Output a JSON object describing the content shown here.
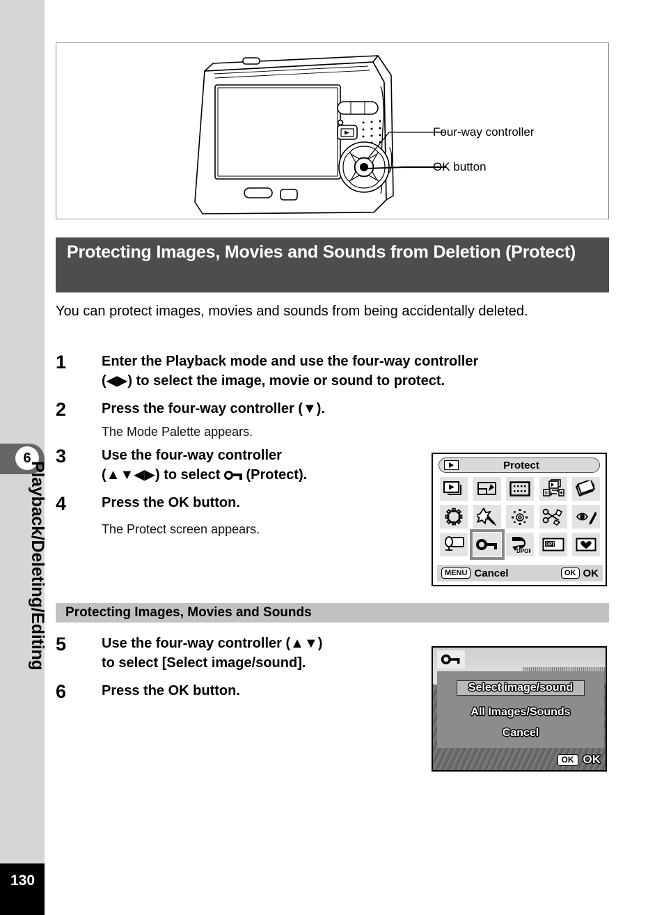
{
  "page": {
    "number": "130",
    "chapter_number": "6",
    "chapter_title": "Playback/Deleting/Editing"
  },
  "illustration": {
    "callouts": [
      {
        "label": "Four-way controller"
      },
      {
        "label": "OK button"
      }
    ],
    "camera_icons": {
      "playback_button": "playback-icon",
      "four_way": "four-way-controller-icon",
      "ok": "ok-button-icon"
    }
  },
  "section": {
    "heading": "Protecting Images, Movies and Sounds from Deletion (Protect)",
    "intro": "You can protect images, movies and sounds from being accidentally deleted."
  },
  "steps": [
    {
      "num": "1",
      "text_a": "Enter the Playback mode and use the four-way controller",
      "text_b": "(◀▶) to select the image, movie or sound to protect.",
      "note": ""
    },
    {
      "num": "2",
      "text_a": "Press the four-way controller (▼).",
      "text_b": "",
      "note": "The Mode Palette appears."
    },
    {
      "num": "3",
      "text_a": "Use the four-way controller",
      "text_b_pre": "(▲▼◀▶) to select ",
      "text_b_post": " (Protect).",
      "note": ""
    },
    {
      "num": "4",
      "text_a": "Press the OK button.",
      "text_b": "",
      "note": "The Protect screen appears."
    },
    {
      "num": "5",
      "text_a": "Use the four-way controller (▲▼)",
      "text_b": "to select [Select image/sound].",
      "note": ""
    },
    {
      "num": "6",
      "text_a": "Press the OK button.",
      "text_b": "",
      "note": ""
    }
  ],
  "subsection": {
    "band_title": "Protecting Images, Movies and Sounds"
  },
  "lcd_mode_palette": {
    "title": "Protect",
    "title_icon": "playback-mode-icon",
    "icons": [
      {
        "name": "slideshow-icon"
      },
      {
        "name": "resize-icon"
      },
      {
        "name": "cropping-icon"
      },
      {
        "name": "image-copy-icon"
      },
      {
        "name": "image-rotation-icon"
      },
      {
        "name": "frame-composite-icon"
      },
      {
        "name": "digital-filter-icon"
      },
      {
        "name": "brightness-filter-icon"
      },
      {
        "name": "red-eye-compensation-icon"
      },
      {
        "name": "digital-filter-pen-icon"
      },
      {
        "name": "voice-memo-icon"
      },
      {
        "name": "protect-key-icon"
      },
      {
        "name": "dpof-icon"
      },
      {
        "name": "start-up-screen-icon"
      },
      {
        "name": "favorite-heart-icon"
      }
    ],
    "selected_icon": "protect-key-icon",
    "bottom_bar": {
      "menu_chip": "MENU",
      "menu_label": "Cancel",
      "ok_chip": "OK",
      "ok_label": "OK"
    }
  },
  "lcd_protect_screen": {
    "badge_icon": "protect-key-icon",
    "options": [
      {
        "label": "Select image/sound",
        "selected": true
      },
      {
        "label": "All Images/Sounds",
        "selected": false
      },
      {
        "label": "Cancel",
        "selected": false
      }
    ],
    "bottom_bar": {
      "ok_chip": "OK",
      "ok_label": "OK"
    }
  },
  "colors": {
    "heading_band": "#4d4d4d",
    "sub_band": "#c2c2c2",
    "rail": "#d6d6d6",
    "rail_tab": "#666666",
    "page_block": "#000000"
  }
}
